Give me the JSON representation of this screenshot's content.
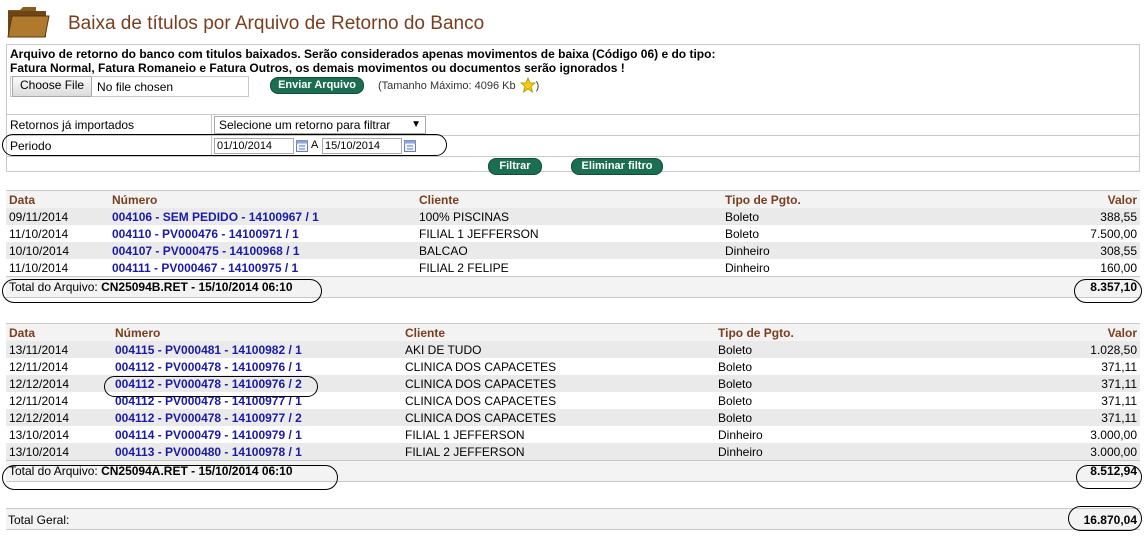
{
  "header": {
    "title": "Baixa de títulos por Arquivo de Retorno do Banco"
  },
  "upload": {
    "info_line1": "Arquivo de retorno do banco com titulos baixados. Serão considerados apenas movimentos de baixa (Código 06) e do tipo:",
    "info_line2": "Fatura Normal, Fatura Romaneio e Fatura Outros, os demais movimentos ou documentos serão ignorados !",
    "choose_file_label": "Choose File",
    "no_file_text": "No file chosen",
    "send_button": "Enviar Arquivo",
    "max_size_text": "(Tamanho Máximo: 4096 Kb"
  },
  "filters": {
    "returns_label": "Retornos já importados",
    "returns_select": "Selecione um retorno para filtrar",
    "period_label": "Periodo",
    "date_from": "01/10/2014",
    "date_sep": "A",
    "date_to": "15/10/2014",
    "filter_button": "Filtrar",
    "clear_button": "Eliminar filtro"
  },
  "columns": {
    "data": "Data",
    "numero": "Número",
    "cliente": "Cliente",
    "tipo": "Tipo de Pgto.",
    "valor": "Valor"
  },
  "files": [
    {
      "total_prefix": "Total do Arquivo:",
      "total_name": "CN25094B.RET - 15/10/2014 06:10",
      "total_value": "8.357,10",
      "rows": [
        {
          "data": "09/11/2014",
          "numero": "004106 - SEM PEDIDO - 14100967 / 1",
          "cliente": "100% PISCINAS",
          "tipo": "Boleto",
          "valor": "388,55"
        },
        {
          "data": "11/10/2014",
          "numero": "004110 - PV000476 - 14100971 / 1",
          "cliente": "FILIAL 1 JEFFERSON",
          "tipo": "Boleto",
          "valor": "7.500,00"
        },
        {
          "data": "10/10/2014",
          "numero": "004107 - PV000475 - 14100968 / 1",
          "cliente": "BALCAO",
          "tipo": "Dinheiro",
          "valor": "308,55"
        },
        {
          "data": "11/10/2014",
          "numero": "004111 - PV000467 - 14100975 / 1",
          "cliente": "FILIAL 2 FELIPE",
          "tipo": "Dinheiro",
          "valor": "160,00"
        }
      ]
    },
    {
      "total_prefix": "Total do Arquivo:",
      "total_name": "CN25094A.RET - 15/10/2014 06:10",
      "total_value": "8.512,94",
      "rows": [
        {
          "data": "13/11/2014",
          "numero": "004115 - PV000481 - 14100982 / 1",
          "cliente": "AKI DE TUDO",
          "tipo": "Boleto",
          "valor": "1.028,50"
        },
        {
          "data": "12/11/2014",
          "numero": "004112 - PV000478 - 14100976 / 1",
          "cliente": "CLINICA DOS CAPACETES",
          "tipo": "Boleto",
          "valor": "371,11"
        },
        {
          "data": "12/12/2014",
          "numero": "004112 - PV000478 - 14100976 / 2",
          "cliente": "CLINICA DOS CAPACETES",
          "tipo": "Boleto",
          "valor": "371,11"
        },
        {
          "data": "12/11/2014",
          "numero": "004112 - PV000478 - 14100977 / 1",
          "cliente": "CLINICA DOS CAPACETES",
          "tipo": "Boleto",
          "valor": "371,11"
        },
        {
          "data": "12/12/2014",
          "numero": "004112 - PV000478 - 14100977 / 2",
          "cliente": "CLINICA DOS CAPACETES",
          "tipo": "Boleto",
          "valor": "371,11"
        },
        {
          "data": "13/10/2014",
          "numero": "004114 - PV000479 - 14100979 / 1",
          "cliente": "FILIAL 1 JEFFERSON",
          "tipo": "Dinheiro",
          "valor": "3.000,00"
        },
        {
          "data": "13/10/2014",
          "numero": "004113 - PV000480 - 14100978 / 1",
          "cliente": "FILIAL 2 JEFFERSON",
          "tipo": "Dinheiro",
          "valor": "3.000,00"
        }
      ]
    }
  ],
  "grand_total": {
    "label": "Total Geral:",
    "value": "16.870,04"
  },
  "icons": {
    "folder": "folder-icon",
    "star": "star-icon",
    "calendar": "calendar-icon"
  },
  "colors": {
    "title": "#7a3e1f",
    "link": "#1a1aa8",
    "button": "#1b6e52"
  }
}
